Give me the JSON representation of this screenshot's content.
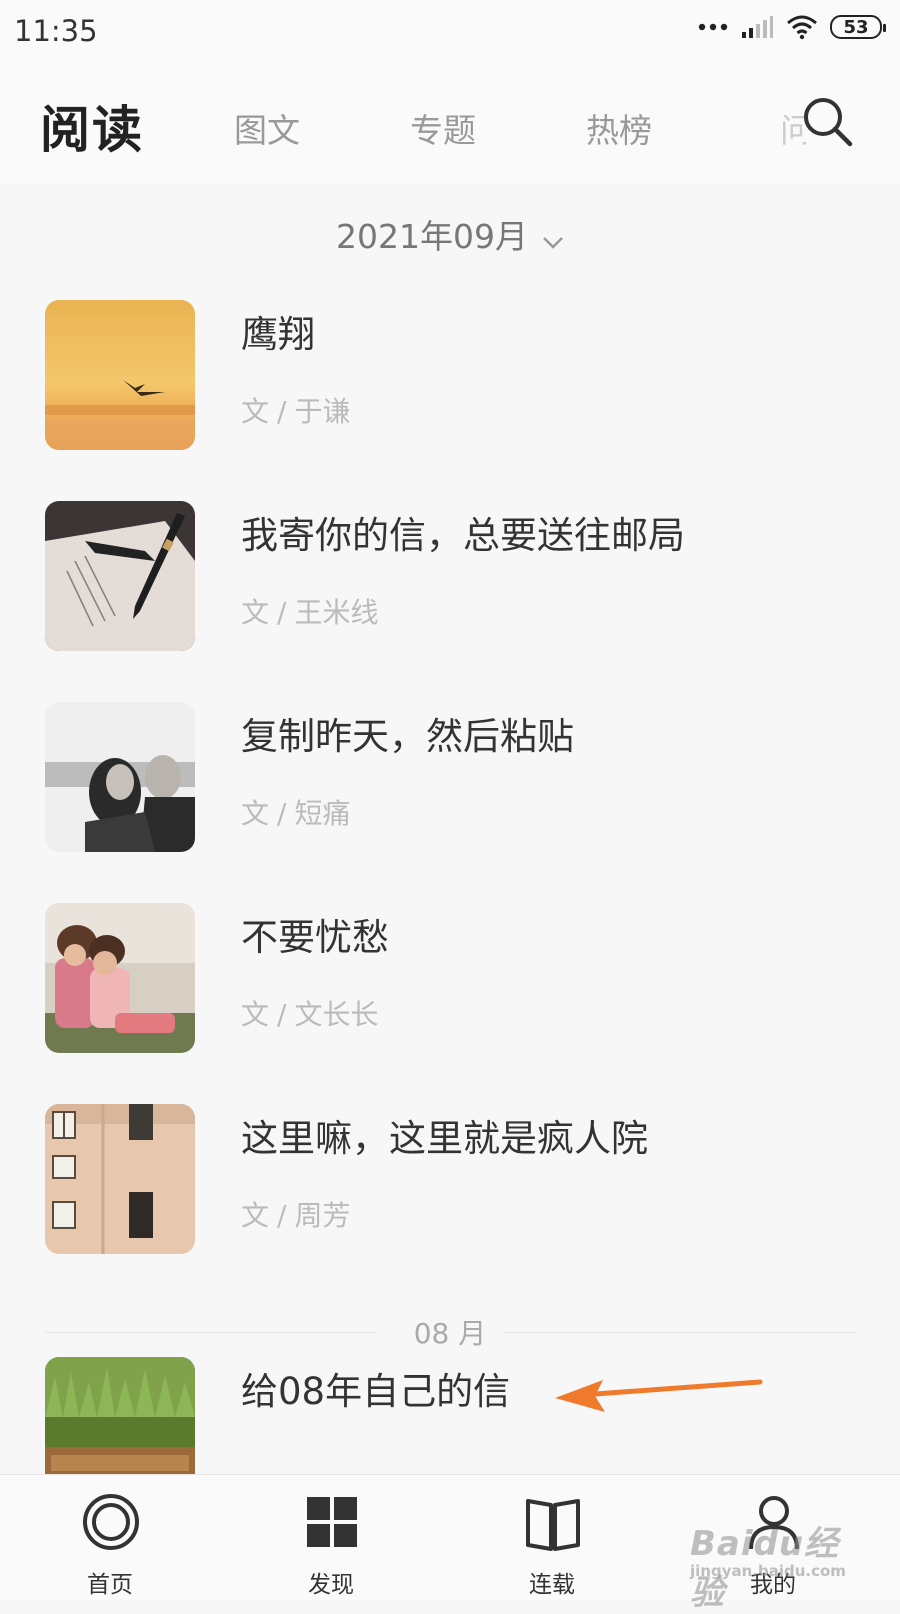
{
  "status_bar": {
    "time": "11:35",
    "battery": "53"
  },
  "header": {
    "title": "阅读",
    "tabs": [
      "图文",
      "专题",
      "热榜",
      "问"
    ]
  },
  "month_selector": "2021年09月",
  "articles": [
    {
      "title": "鹰翔",
      "author_prefix": "文",
      "author_sep": "/",
      "author": "于谦"
    },
    {
      "title": "我寄你的信，总要送往邮局",
      "author_prefix": "文",
      "author_sep": "/",
      "author": "王米线"
    },
    {
      "title": "复制昨天，然后粘贴",
      "author_prefix": "文",
      "author_sep": "/",
      "author": "短痛"
    },
    {
      "title": "不要忧愁",
      "author_prefix": "文",
      "author_sep": "/",
      "author": "文长长"
    },
    {
      "title": "这里嘛，这里就是疯人院",
      "author_prefix": "文",
      "author_sep": "/",
      "author": "周芳"
    }
  ],
  "section_divider": "08 月",
  "highlight_article": {
    "title": "给08年自己的信",
    "arrow_color": "#f07a2c"
  },
  "bottom_nav": [
    "首页",
    "发现",
    "连载",
    "我的"
  ],
  "watermark": {
    "big": "Baidu经验",
    "small": "jingyan.baidu.com"
  }
}
